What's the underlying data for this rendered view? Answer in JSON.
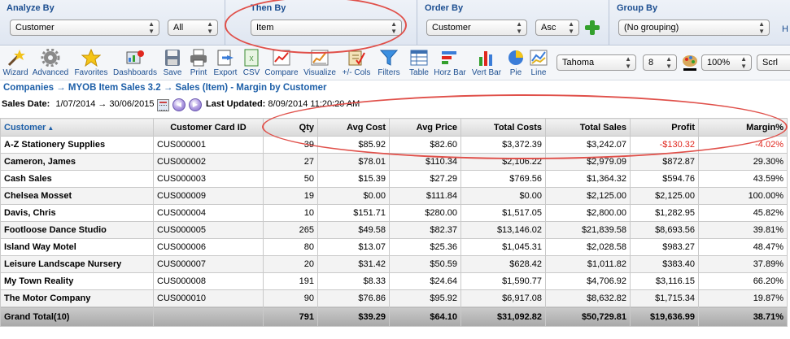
{
  "selectors": {
    "analyze_by": {
      "label": "Analyze By",
      "value": "Customer",
      "secondary": "All"
    },
    "then_by": {
      "label": "Then By",
      "value": "Item"
    },
    "order_by": {
      "label": "Order By",
      "value": "Customer",
      "direction": "Asc"
    },
    "group_by": {
      "label": "Group By",
      "value": "(No grouping)"
    },
    "overflow_letter": "H"
  },
  "toolbar": {
    "buttons": [
      {
        "label": "Wizard",
        "icon": "wizard-wand-icon"
      },
      {
        "label": "Advanced",
        "icon": "gear-icon"
      },
      {
        "label": "Favorites",
        "icon": "star-icon"
      },
      {
        "label": "Dashboards",
        "icon": "dashboard-icon"
      },
      {
        "label": "Save",
        "icon": "floppy-disk-icon"
      },
      {
        "label": "Print",
        "icon": "printer-icon"
      },
      {
        "label": "Export",
        "icon": "export-icon"
      },
      {
        "label": "CSV",
        "icon": "csv-icon"
      },
      {
        "label": "Compare",
        "icon": "compare-chart-icon"
      },
      {
        "label": "Visualize",
        "icon": "visualize-icon"
      },
      {
        "label": "+/- Cols",
        "icon": "columns-edit-icon"
      },
      {
        "label": "Filters",
        "icon": "funnel-icon"
      },
      {
        "label": "Table",
        "icon": "table-icon"
      },
      {
        "label": "Horz Bar",
        "icon": "horizontal-bar-chart-icon"
      },
      {
        "label": "Vert Bar",
        "icon": "vertical-bar-chart-icon"
      },
      {
        "label": "Pie",
        "icon": "pie-chart-icon"
      },
      {
        "label": "Line",
        "icon": "line-chart-icon"
      }
    ],
    "font_value": "Tahoma",
    "font_size_value": "8",
    "zoom_value": "100%",
    "scroll_label": "Scrl"
  },
  "breadcrumb": "Companies →  MYOB Item Sales 3.2 →  Sales (Item) - Margin by Customer",
  "meta": {
    "sales_date_label": "Sales Date:",
    "sales_date_value": "1/07/2014 → 30/06/2015",
    "last_updated_label": "Last Updated:",
    "last_updated_value": "8/09/2014 11:20:20 AM"
  },
  "table": {
    "columns": [
      "Customer",
      "Customer Card ID",
      "Qty",
      "Avg Cost",
      "Avg Price",
      "Total Costs",
      "Total Sales",
      "Profit",
      "Margin%"
    ],
    "rows": [
      [
        "A-Z Stationery Supplies",
        "CUS000001",
        "39",
        "$85.92",
        "$82.60",
        "$3,372.39",
        "$3,242.07",
        "-$130.32",
        "-4.02%"
      ],
      [
        "Cameron, James",
        "CUS000002",
        "27",
        "$78.01",
        "$110.34",
        "$2,106.22",
        "$2,979.09",
        "$872.87",
        "29.30%"
      ],
      [
        "Cash Sales",
        "CUS000003",
        "50",
        "$15.39",
        "$27.29",
        "$769.56",
        "$1,364.32",
        "$594.76",
        "43.59%"
      ],
      [
        "Chelsea Mosset",
        "CUS000009",
        "19",
        "$0.00",
        "$111.84",
        "$0.00",
        "$2,125.00",
        "$2,125.00",
        "100.00%"
      ],
      [
        "Davis, Chris",
        "CUS000004",
        "10",
        "$151.71",
        "$280.00",
        "$1,517.05",
        "$2,800.00",
        "$1,282.95",
        "45.82%"
      ],
      [
        "Footloose Dance Studio",
        "CUS000005",
        "265",
        "$49.58",
        "$82.37",
        "$13,146.02",
        "$21,839.58",
        "$8,693.56",
        "39.81%"
      ],
      [
        "Island Way Motel",
        "CUS000006",
        "80",
        "$13.07",
        "$25.36",
        "$1,045.31",
        "$2,028.58",
        "$983.27",
        "48.47%"
      ],
      [
        "Leisure Landscape Nursery",
        "CUS000007",
        "20",
        "$31.42",
        "$50.59",
        "$628.42",
        "$1,011.82",
        "$383.40",
        "37.89%"
      ],
      [
        "My Town Reality",
        "CUS000008",
        "191",
        "$8.33",
        "$24.64",
        "$1,590.77",
        "$4,706.92",
        "$3,116.15",
        "66.20%"
      ],
      [
        "The Motor Company",
        "CUS000010",
        "90",
        "$76.86",
        "$95.92",
        "$6,917.08",
        "$8,632.82",
        "$1,715.34",
        "19.87%"
      ]
    ],
    "total": [
      "Grand Total(10)",
      "",
      "791",
      "$39.29",
      "$64.10",
      "$31,092.82",
      "$50,729.81",
      "$19,636.99",
      "38.71%"
    ]
  },
  "colors": {
    "accent": "#1d5fa8",
    "negative": "#e0281f",
    "annotation": "#e0504a",
    "add_button": "#33a02c"
  }
}
